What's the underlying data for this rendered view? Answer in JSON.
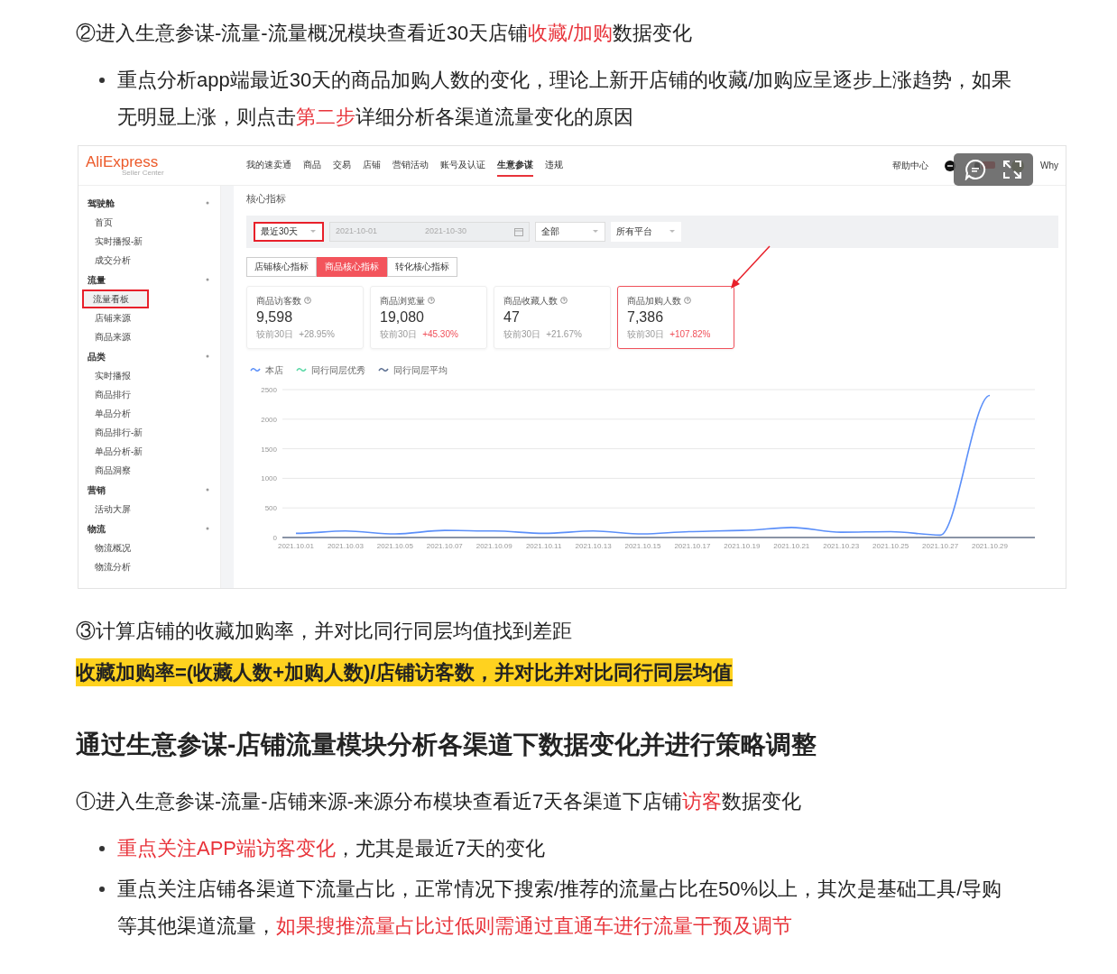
{
  "article": [
    {
      "kind": "paragraph",
      "parts": [
        {
          "text": "②进入生意参谋-流量-流量概况模块查看近30天店铺",
          "emphasis": false
        },
        {
          "text": "收藏/加购",
          "emphasis": true
        },
        {
          "text": "数据变化",
          "emphasis": false
        }
      ]
    },
    {
      "kind": "bullets",
      "items": [
        {
          "parts": [
            {
              "text": "重点分析app端最近30天的商品加购人数的变化，理论上新开店铺的收藏/加购应呈逐步上涨趋势，如果无明显上涨，则点击",
              "emphasis": false
            },
            {
              "text": "第二步",
              "emphasis": true
            },
            {
              "text": "详细分析各渠道流量变化的原因",
              "emphasis": false
            }
          ]
        }
      ]
    },
    {
      "kind": "figure",
      "screenshot": {
        "logo": "AliExpress",
        "logo_sub": "Seller Center",
        "nav": [
          {
            "label": "我的速卖通",
            "selected": false
          },
          {
            "label": "商品",
            "selected": false
          },
          {
            "label": "交易",
            "selected": false
          },
          {
            "label": "店铺",
            "selected": false
          },
          {
            "label": "营销活动",
            "selected": false
          },
          {
            "label": "账号及认证",
            "selected": false
          },
          {
            "label": "生意参谋",
            "selected": true
          },
          {
            "label": "违规",
            "selected": false
          }
        ],
        "help": "帮助中心",
        "user": "Why",
        "sidebar": [
          {
            "label": "驾驶舱",
            "expanded": true,
            "children": [
              {
                "label": "首页",
                "selected": false,
                "highlighted": false
              },
              {
                "label": "实时播报-新",
                "selected": false,
                "highlighted": false
              },
              {
                "label": "成交分析",
                "selected": false,
                "highlighted": false
              }
            ]
          },
          {
            "label": "流量",
            "expanded": true,
            "children": [
              {
                "label": "流量看板",
                "selected": true,
                "highlighted": true
              },
              {
                "label": "店铺来源",
                "selected": false,
                "highlighted": false
              },
              {
                "label": "商品来源",
                "selected": false,
                "highlighted": false
              }
            ]
          },
          {
            "label": "品类",
            "expanded": true,
            "children": [
              {
                "label": "实时播报",
                "selected": false,
                "highlighted": false
              },
              {
                "label": "商品排行",
                "selected": false,
                "highlighted": false
              },
              {
                "label": "单品分析",
                "selected": false,
                "highlighted": false
              },
              {
                "label": "商品排行-新",
                "selected": false,
                "highlighted": false
              },
              {
                "label": "单品分析-新",
                "selected": false,
                "highlighted": false
              },
              {
                "label": "商品洞察",
                "selected": false,
                "highlighted": false
              }
            ]
          },
          {
            "label": "营销",
            "expanded": true,
            "children": [
              {
                "label": "活动大屏",
                "selected": false,
                "highlighted": false
              }
            ]
          },
          {
            "label": "物流",
            "expanded": true,
            "children": [
              {
                "label": "物流概况",
                "selected": false,
                "highlighted": false
              },
              {
                "label": "物流分析",
                "selected": false,
                "highlighted": false
              }
            ]
          }
        ],
        "title": "核心指标",
        "filters": {
          "period": "最近30天",
          "period_highlighted": true,
          "start_date": "2021-10-01",
          "end_date": "2021-10-30",
          "category": "全部",
          "platform": "所有平台"
        },
        "tabs": [
          {
            "label": "店铺核心指标",
            "selected": false
          },
          {
            "label": "商品核心指标",
            "selected": true
          },
          {
            "label": "转化核心指标",
            "selected": false
          }
        ],
        "cards": [
          {
            "label": "商品访客数",
            "value": "9,598",
            "compare": "较前30日",
            "change": "+28.95%",
            "color": "#999999",
            "highlighted": false
          },
          {
            "label": "商品浏览量",
            "value": "19,080",
            "compare": "较前30日",
            "change": "+45.30%",
            "color": "#f0505a",
            "highlighted": false
          },
          {
            "label": "商品收藏人数",
            "value": "47",
            "compare": "较前30日",
            "change": "+21.67%",
            "color": "#999999",
            "highlighted": false
          },
          {
            "label": "商品加购人数",
            "value": "7,386",
            "compare": "较前30日",
            "change": "+107.82%",
            "color": "#f0505a",
            "highlighted": true
          }
        ],
        "legend": [
          {
            "label": "同行同层优秀",
            "color": "#5ad8a6"
          },
          {
            "label": "同行同层平均",
            "color": "#5d7092"
          }
        ],
        "chart_data": {
          "type": "line",
          "grid": true,
          "x": [
            "2021.10.01",
            "2021.10.03",
            "2021.10.05",
            "2021.10.07",
            "2021.10.09",
            "2021.10.11",
            "2021.10.13",
            "2021.10.15",
            "2021.10.17",
            "2021.10.19",
            "2021.10.21",
            "2021.10.23",
            "2021.10.25",
            "2021.10.27",
            "2021.10.29"
          ],
          "ylim": [
            0,
            2500
          ],
          "yticks": [
            0,
            500,
            1000,
            1500,
            2000,
            2500
          ],
          "series": [
            {
              "name": "本店",
              "color": "#5b8ff9",
              "values": [
                70,
                110,
                60,
                120,
                110,
                70,
                110,
                60,
                100,
                120,
                170,
                90,
                100,
                40,
                2400
              ]
            }
          ]
        }
      }
    },
    {
      "kind": "paragraph",
      "parts": [
        {
          "text": "③计算店铺的收藏加购率，并对比同行同层均值找到差距",
          "emphasis": false
        }
      ]
    },
    {
      "kind": "highlight",
      "text": "收藏加购率=(收藏人数+加购人数)/店铺访客数，并对比并对比同行同层均值"
    },
    {
      "kind": "heading",
      "text": "通过生意参谋-店铺流量模块分析各渠道下数据变化并进行策略调整"
    },
    {
      "kind": "paragraph",
      "parts": [
        {
          "text": "①进入生意参谋-流量-店铺来源-来源分布模块查看近7天各渠道下店铺",
          "emphasis": false
        },
        {
          "text": "访客",
          "emphasis": true
        },
        {
          "text": "数据变化",
          "emphasis": false
        }
      ]
    },
    {
      "kind": "bullets",
      "items": [
        {
          "parts": [
            {
              "text": "重点关注APP端访客变化",
              "emphasis": true
            },
            {
              "text": "，尤其是最近7天的变化",
              "emphasis": false
            }
          ]
        },
        {
          "parts": [
            {
              "text": "重点关注店铺各渠道下流量占比，正常情况下搜索/推荐的流量占比在50%以上，其次是基础工具/导购等其他渠道流量，",
              "emphasis": false
            },
            {
              "text": "如果搜推流量占比过低则需通过直通车进行流量干预及调节",
              "emphasis": true
            }
          ]
        }
      ]
    }
  ]
}
